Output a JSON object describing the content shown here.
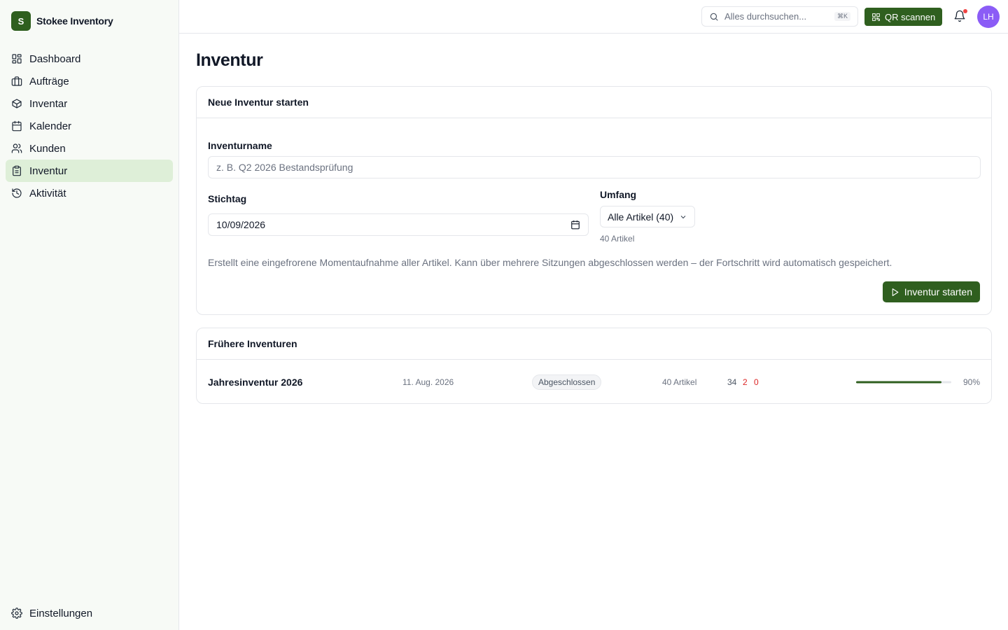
{
  "brand": {
    "logo_letter": "S",
    "name": "Stokee Inventory"
  },
  "sidebar": {
    "items": [
      {
        "label": "Dashboard",
        "icon": "dashboard-icon"
      },
      {
        "label": "Aufträge",
        "icon": "briefcase-icon"
      },
      {
        "label": "Inventar",
        "icon": "box-icon"
      },
      {
        "label": "Kalender",
        "icon": "calendar-icon"
      },
      {
        "label": "Kunden",
        "icon": "users-icon"
      },
      {
        "label": "Inventur",
        "icon": "clipboard-icon",
        "active": true
      },
      {
        "label": "Aktivität",
        "icon": "history-icon"
      }
    ],
    "settings_label": "Einstellungen"
  },
  "topbar": {
    "search_placeholder": "Alles durchsuchen...",
    "search_shortcut": "⌘K",
    "qr_label": "QR scannen",
    "avatar_initials": "LH"
  },
  "page": {
    "title": "Inventur"
  },
  "new_inventory": {
    "header": "Neue Inventur starten",
    "name_label": "Inventurname",
    "name_placeholder": "z. B. Q2 2026 Bestandsprüfung",
    "date_label": "Stichtag",
    "date_value": "10/09/2026",
    "scope_label": "Umfang",
    "scope_value": "Alle Artikel (40)",
    "scope_hint": "40 Artikel",
    "description": "Erstellt eine eingefrorene Momentaufnahme aller Artikel. Kann über mehrere Sitzungen abgeschlossen werden – der Fortschritt wird automatisch gespeichert.",
    "start_label": "Inventur starten"
  },
  "past_inventories": {
    "header": "Frühere Inventuren",
    "rows": [
      {
        "name": "Jahresinventur 2026",
        "date": "11. Aug. 2026",
        "status": "Abgeschlossen",
        "count": "40 Artikel",
        "ok": "34",
        "diff": "2",
        "missing": "0",
        "progress": 0.9,
        "percent": "90%"
      }
    ]
  },
  "colors": {
    "accent": "#2f5f1f",
    "active_bg": "#deefd8",
    "danger": "#dc2626",
    "avatar": "#8b5cf6"
  }
}
